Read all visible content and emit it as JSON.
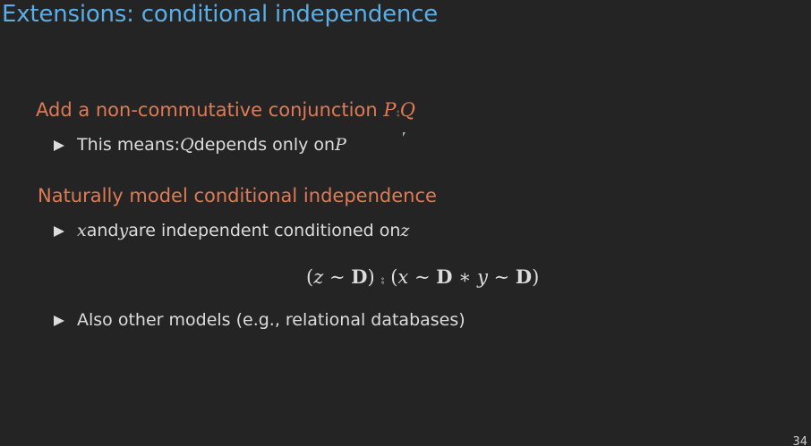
{
  "slide": {
    "title": "Extensions: conditional independence",
    "page_number": "34"
  },
  "section1": {
    "heading_text": "Add a non-commutative conjunction ",
    "heading_math_p": "P",
    "heading_math_op": "⨾",
    "heading_math_q": "Q",
    "bullet_prefix": "This means: ",
    "bullet_math_q": "Q",
    "bullet_middle": " depends only on ",
    "bullet_math_p": "P"
  },
  "section2": {
    "heading_text": "Naturally model conditional independence",
    "bullet1_math_x": "x",
    "bullet1_and": " and ",
    "bullet1_math_y": "y",
    "bullet1_rest": " are independent conditioned on ",
    "bullet1_math_z": "z",
    "equation": {
      "open1": "(",
      "z": "z",
      "sim1": " ∼ ",
      "D1": "D",
      "close1": ")",
      "seq": " ⨾ ",
      "open2": "(",
      "x": "x",
      "sim2": " ∼ ",
      "D2": "D",
      "star": " ∗ ",
      "y": "y",
      "sim3": " ∼ ",
      "D3": "D",
      "close2": ")"
    },
    "bullet2_text": "Also other models (e.g., relational databases)"
  }
}
